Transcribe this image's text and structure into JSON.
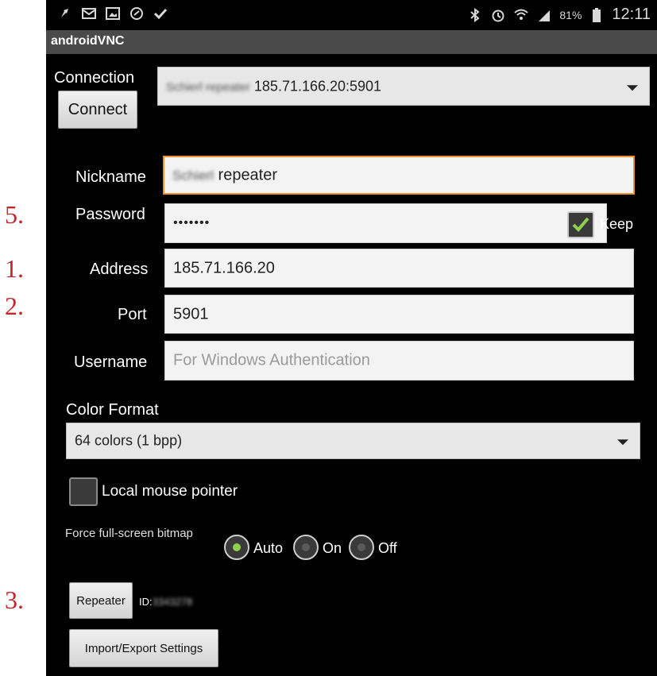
{
  "annotations": [
    "5.",
    "1.",
    "2.",
    "3."
  ],
  "status_bar": {
    "battery": "81%",
    "time": "12:11",
    "left_icons": [
      "pin-icon",
      "mail-icon",
      "image-icon",
      "sync-icon",
      "check-icon"
    ],
    "right_icons": [
      "bluetooth-icon",
      "alarm-icon",
      "wifi-icon",
      "signal-icon",
      "battery-icon"
    ]
  },
  "app": {
    "title": "androidVNC"
  },
  "connection": {
    "label": "Connection",
    "connect_button": "Connect",
    "selected_prefix": "Schierl repeater",
    "selected_address": "185.71.166.20:5901"
  },
  "form": {
    "nickname_label": "Nickname",
    "nickname_prefix": "Schierl",
    "nickname_value": "repeater",
    "password_label": "Password",
    "password_value": "•••••••",
    "keep_label": "Keep",
    "keep_checked": true,
    "address_label": "Address",
    "address_value": "185.71.166.20",
    "port_label": "Port",
    "port_value": "5901",
    "username_label": "Username",
    "username_placeholder": "For Windows Authentication"
  },
  "color_format": {
    "label": "Color Format",
    "selected": "64 colors (1 bpp)"
  },
  "local_mouse": {
    "label": "Local mouse pointer",
    "checked": false
  },
  "bitmap": {
    "label": "Force full-screen bitmap",
    "options": [
      "Auto",
      "On",
      "Off"
    ],
    "selected": "Auto"
  },
  "repeater": {
    "button": "Repeater",
    "id_label": "ID:",
    "id_value": "3343278"
  },
  "import_export_button": "Import/Export Settings",
  "colors": {
    "accent": "#f0922b",
    "check": "#8fd14f",
    "annotation": "#c0282e"
  }
}
